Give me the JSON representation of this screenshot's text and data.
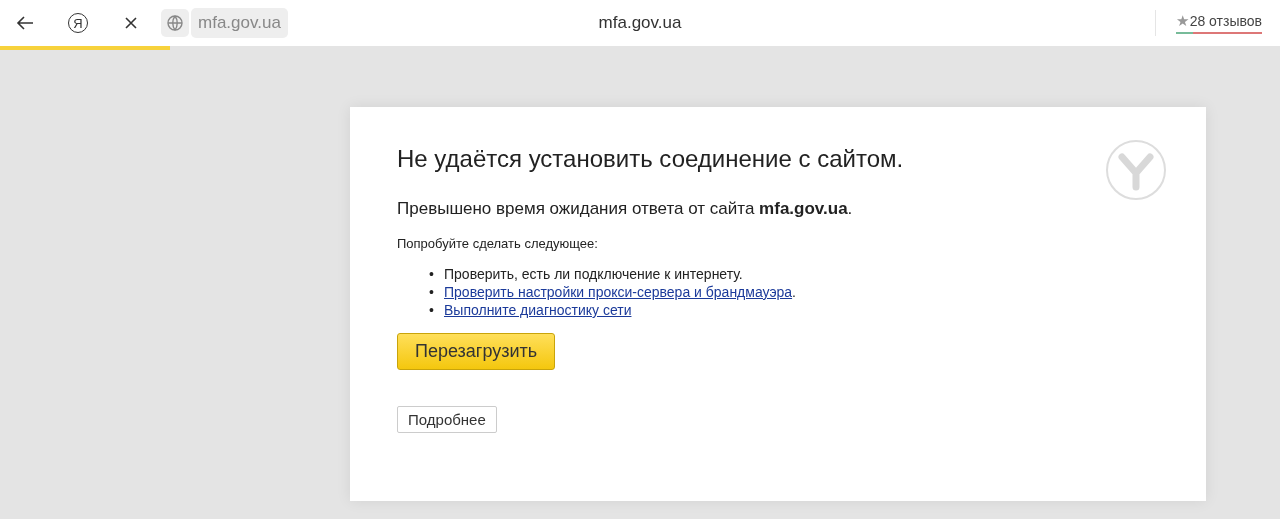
{
  "toolbar": {
    "home_glyph": "Я",
    "address": "mfa.gov.ua",
    "title": "mfa.gov.ua",
    "reviews": {
      "star": "★",
      "text": "28 отзывов",
      "level": 0.2
    }
  },
  "loading": {
    "level": 0.133
  },
  "error": {
    "heading": "Не удаётся установить соединение с сайтом.",
    "message": "Превышено время ожидания ответа от сайта **mfa.gov.ua**.",
    "suggest": "Попробуйте сделать следующее:",
    "items": [
      {
        "kind": "text",
        "bullet": "•",
        "text": "Проверить, есть ли подключение к интернету."
      },
      {
        "kind": "link",
        "bullet": "•",
        "text": "Проверить настройки прокси-сервера и брандмауэра",
        "suffix": "."
      },
      {
        "kind": "link",
        "bullet": "•",
        "text": "Выполните диагностику сети"
      }
    ],
    "reload_button": "Перезагрузить",
    "details_button": "Подробнее"
  }
}
